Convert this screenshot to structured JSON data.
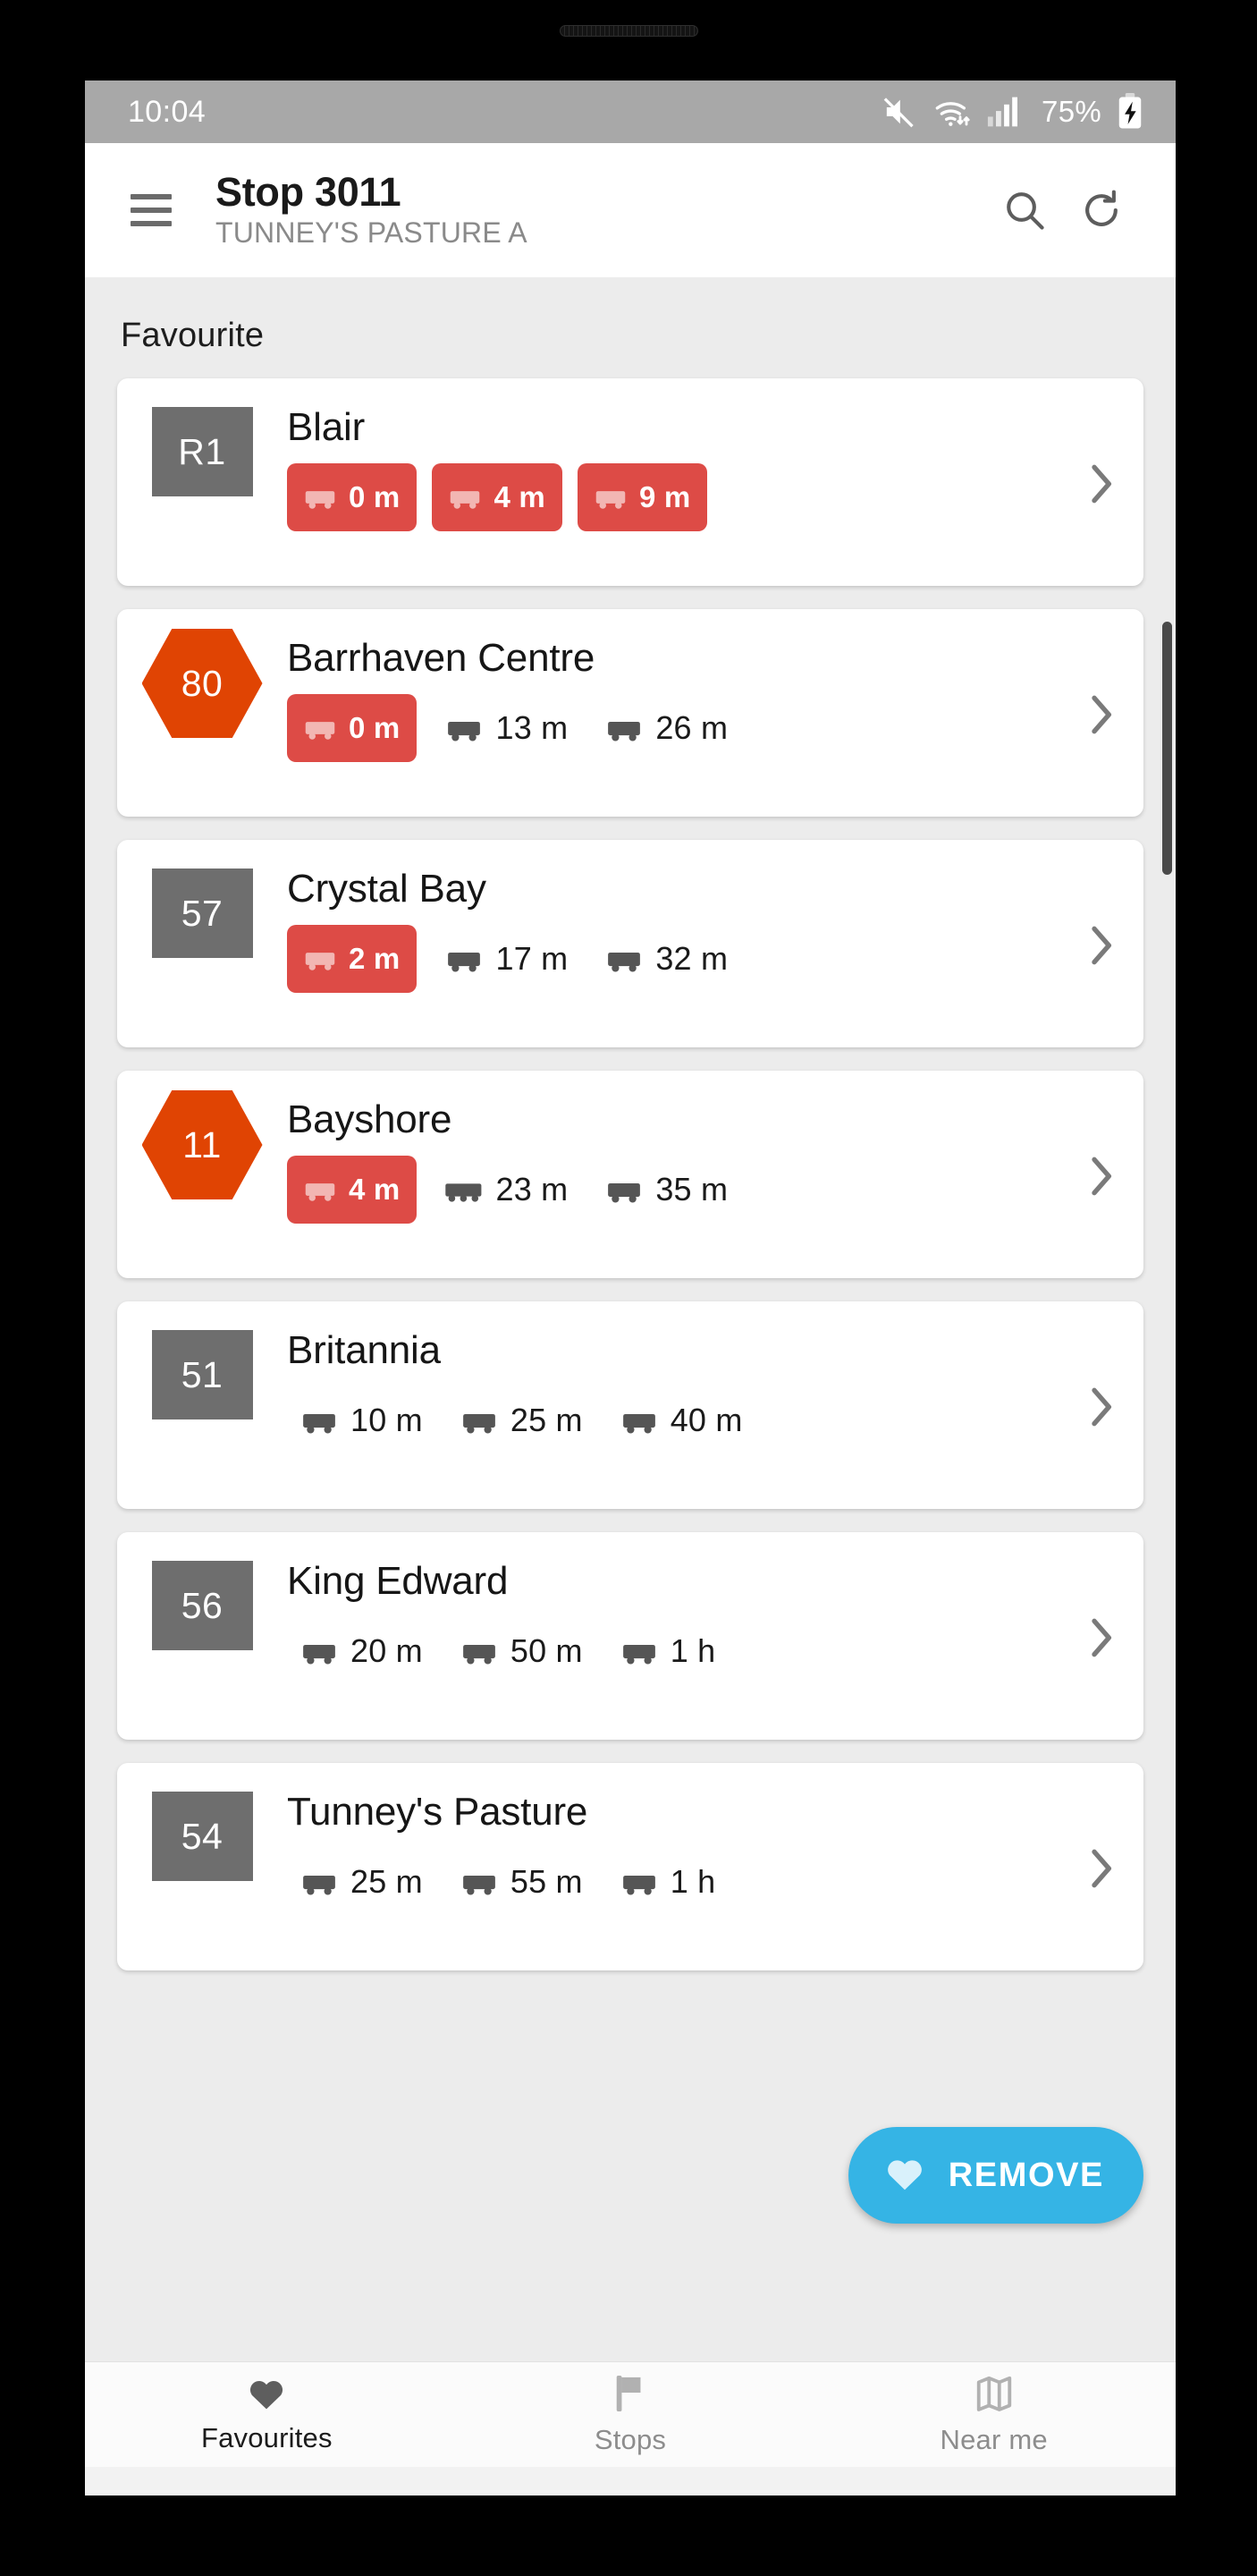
{
  "status_bar": {
    "time": "10:04",
    "battery_percent": "75%",
    "icons": [
      "mute-icon",
      "wifi-icon",
      "signal-icon",
      "battery-charging-icon"
    ]
  },
  "app_bar": {
    "menu_icon": "hamburger-menu-icon",
    "title": "Stop 3011",
    "subtitle": "TUNNEY'S PASTURE A",
    "search_icon": "search-icon",
    "refresh_icon": "refresh-icon"
  },
  "section": {
    "header": "Favourite"
  },
  "colors": {
    "badge_gray": "#6e6e6e",
    "badge_orange": "#e04403",
    "chip_red": "#dd4b46",
    "fab_blue": "#35b4e5",
    "screen_bg": "#ececec"
  },
  "routes": [
    {
      "badge": "R1",
      "badge_shape": "rect",
      "name": "Blair",
      "times": [
        {
          "label": "0 m",
          "live": true,
          "icon": "bus-icon"
        },
        {
          "label": "4 m",
          "live": true,
          "icon": "bus-icon"
        },
        {
          "label": "9 m",
          "live": true,
          "icon": "bus-icon"
        }
      ]
    },
    {
      "badge": "80",
      "badge_shape": "hex",
      "name": "Barrhaven Centre",
      "times": [
        {
          "label": "0 m",
          "live": true,
          "icon": "bus-icon"
        },
        {
          "label": "13 m",
          "live": false,
          "icon": "bus-icon"
        },
        {
          "label": "26 m",
          "live": false,
          "icon": "bus-icon"
        }
      ]
    },
    {
      "badge": "57",
      "badge_shape": "rect",
      "name": "Crystal Bay",
      "times": [
        {
          "label": "2 m",
          "live": true,
          "icon": "bus-icon"
        },
        {
          "label": "17 m",
          "live": false,
          "icon": "bus-icon"
        },
        {
          "label": "32 m",
          "live": false,
          "icon": "bus-icon"
        }
      ]
    },
    {
      "badge": "11",
      "badge_shape": "hex",
      "name": "Bayshore",
      "times": [
        {
          "label": "4 m",
          "live": true,
          "icon": "bus-icon"
        },
        {
          "label": "23 m",
          "live": false,
          "icon": "articulated-bus-icon"
        },
        {
          "label": "35 m",
          "live": false,
          "icon": "bus-icon"
        }
      ]
    },
    {
      "badge": "51",
      "badge_shape": "rect",
      "name": "Britannia",
      "times": [
        {
          "label": "10 m",
          "live": false,
          "icon": "bus-icon"
        },
        {
          "label": "25 m",
          "live": false,
          "icon": "bus-icon"
        },
        {
          "label": "40 m",
          "live": false,
          "icon": "bus-icon"
        }
      ]
    },
    {
      "badge": "56",
      "badge_shape": "rect",
      "name": "King Edward",
      "times": [
        {
          "label": "20 m",
          "live": false,
          "icon": "bus-icon"
        },
        {
          "label": "50 m",
          "live": false,
          "icon": "bus-icon"
        },
        {
          "label": "1 h",
          "live": false,
          "icon": "bus-icon"
        }
      ]
    },
    {
      "badge": "54",
      "badge_shape": "rect",
      "name": "Tunney's Pasture",
      "times": [
        {
          "label": "25 m",
          "live": false,
          "icon": "bus-icon"
        },
        {
          "label": "55 m",
          "live": false,
          "icon": "bus-icon"
        },
        {
          "label": "1 h",
          "live": false,
          "icon": "bus-icon"
        }
      ]
    }
  ],
  "fab": {
    "label": "REMOVE",
    "icon": "heart-icon"
  },
  "bottom_nav": [
    {
      "label": "Favourites",
      "icon": "heart-icon",
      "active": true
    },
    {
      "label": "Stops",
      "icon": "flag-icon",
      "active": false
    },
    {
      "label": "Near me",
      "icon": "map-icon",
      "active": false
    }
  ],
  "system_nav": [
    {
      "name": "recents-button",
      "icon": "recents-icon"
    },
    {
      "name": "home-button",
      "icon": "home-icon"
    },
    {
      "name": "back-button",
      "icon": "back-chevron-icon"
    }
  ]
}
